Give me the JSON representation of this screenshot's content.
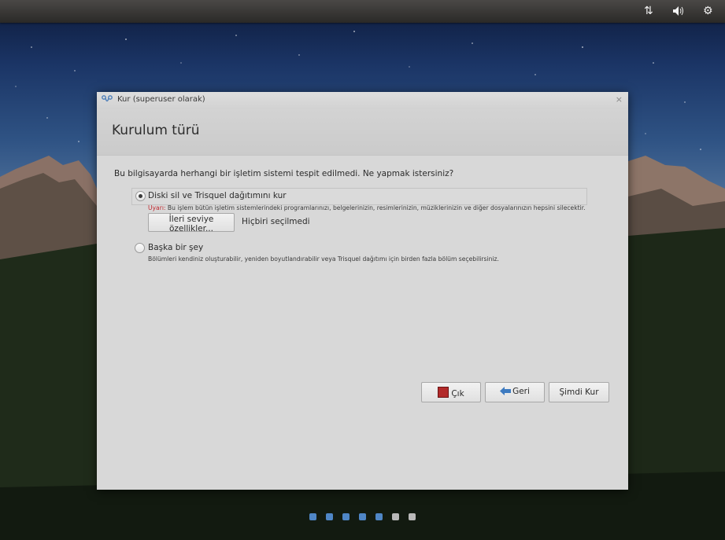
{
  "window": {
    "title": "Kur (superuser olarak)",
    "close_glyph": "×"
  },
  "header": {
    "title": "Kurulum türü"
  },
  "question": "Bu bilgisayarda herhangi bir işletim sistemi tespit edilmedi. Ne yapmak istersiniz?",
  "options": [
    {
      "label": "Diski sil ve Trisquel dağıtımını kur",
      "selected": true,
      "warning_prefix": "Uyarı:",
      "warning_text": " Bu işlem bütün işletim sistemlerindeki programlarınızı, belgelerinizin, resimlerinizin, müziklerinizin ve diğer dosyalarınızın hepsini silecektir.",
      "advanced_button": "İleri seviye özellikler...",
      "advanced_status": "Hiçbiri seçilmedi"
    },
    {
      "label": "Başka bir şey",
      "selected": false,
      "description": "Bölümleri kendiniz oluşturabilir, yeniden boyutlandırabilir veya Trisquel dağıtımı için birden fazla bölüm seçebilirsiniz."
    }
  ],
  "buttons": {
    "quit": "Çık",
    "back": "Geri",
    "install": "Şimdi Kur"
  },
  "progress": {
    "total_steps": 7,
    "completed_steps": 5,
    "active_color": "#4f86c6",
    "inactive_color": "#b9b9b9"
  },
  "indicators": {
    "network_icon": "network-updown-icon",
    "sound_icon": "speaker-icon",
    "settings_icon": "gear-icon"
  }
}
